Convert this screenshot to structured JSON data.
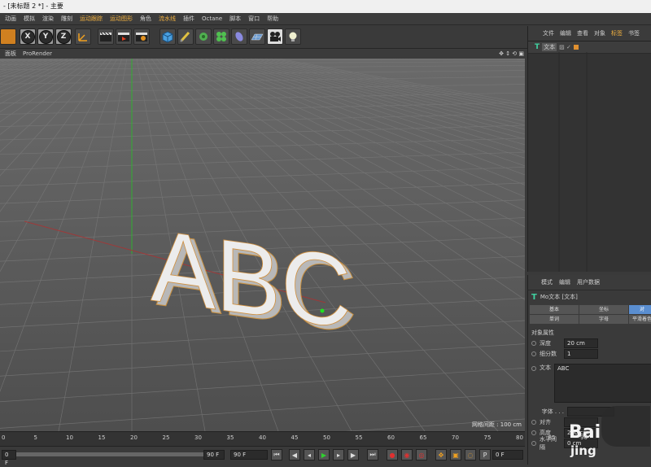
{
  "window": {
    "title": "- [未标题 2 *] - 主要"
  },
  "menu": [
    "动画",
    "模拟",
    "渲染",
    "雕刻",
    "运动跟踪",
    "运动图形",
    "角色",
    "流水线",
    "插件",
    "Octane",
    "脚本",
    "窗口",
    "帮助"
  ],
  "menu_highlighted": [
    "运动跟踪",
    "运动图形",
    "流水线"
  ],
  "toolbar": {
    "axis_x": "X",
    "axis_y": "Y",
    "axis_z": "Z"
  },
  "viewport": {
    "menu": [
      "面板",
      "ProRender"
    ],
    "object_text": "ABC",
    "grid_info": "网格间距 : 100 cm"
  },
  "object_manager": {
    "tabs": [
      "文件",
      "编辑",
      "查看",
      "对象",
      "标签",
      "书签"
    ],
    "active_tab": "标签",
    "object_name": "文本"
  },
  "attribute_manager": {
    "tabs": [
      "模式",
      "编辑",
      "用户数据"
    ],
    "object_title": "Mo文本 [文本]",
    "tab_buttons": [
      "基本",
      "坐标",
      "对",
      "单词",
      "字母",
      "平滑着色"
    ],
    "section": "对象属性",
    "depth_label": "深度",
    "depth_value": "20 cm",
    "subdiv_label": "细分数",
    "subdiv_value": "1",
    "text_label": "文本",
    "text_value": "ABC",
    "font_label": "字体 . . .",
    "align_label": "对齐",
    "height_label": "高度",
    "height_value": "200 cm",
    "hspacing_label": "水平间隔",
    "hspacing_value": "0 cm"
  },
  "timeline": {
    "ticks": [
      "0",
      "5",
      "10",
      "15",
      "20",
      "25",
      "30",
      "35",
      "40",
      "45",
      "50",
      "55",
      "60",
      "65",
      "70",
      "75",
      "80",
      "85",
      "90"
    ],
    "frame_start": "0 F",
    "frame_end_left": "90 F",
    "frame_end_right": "90 F",
    "current_frame": "0 F"
  },
  "watermark": {
    "line1": "Bai",
    "line2": "jing"
  },
  "colors": {
    "accent": "#f0b040",
    "selected_button": "#5a8ed0",
    "viewport_bg": "#5a5a5a"
  }
}
